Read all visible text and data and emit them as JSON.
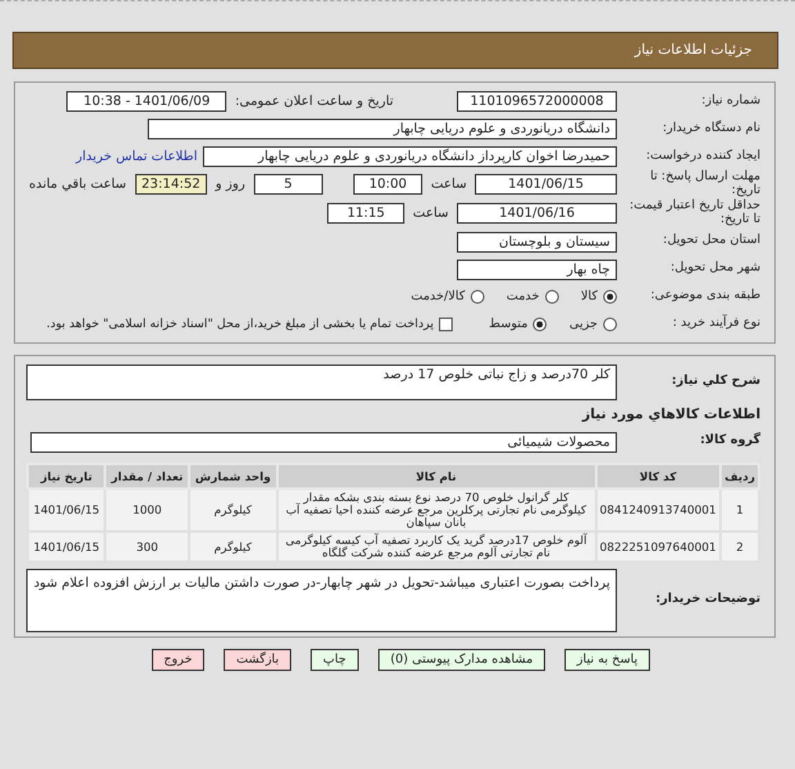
{
  "header": {
    "title": "جزئیات اطلاعات نیاز"
  },
  "need_number": {
    "label": "شماره نیاز:",
    "value": "1101096572000008"
  },
  "announce": {
    "label": "تاریخ و ساعت اعلان عمومی:",
    "value": "1401/06/09 - 10:38"
  },
  "buyer_org": {
    "label": "نام دستگاه خریدار:",
    "value": "دانشگاه دریانوردی و علوم دریایی چابهار"
  },
  "creator": {
    "label": "ایجاد کننده درخواست:",
    "value": "حمیدرضا اخوان کارپرداز دانشگاه دریانوردی و علوم دریایی چابهار",
    "link": "اطلاعات تماس خریدار"
  },
  "deadline": {
    "label": "مهلت ارسال پاسخ: تا تاریخ:",
    "date": "1401/06/15",
    "time_label": "ساعت",
    "time": "10:00",
    "days": "5",
    "days_label": "روز و",
    "remaining": "23:14:52",
    "remaining_label": "ساعت باقي مانده"
  },
  "validity": {
    "label": "حداقل تاریخ اعتبار قیمت: تا تاریخ:",
    "date": "1401/06/16",
    "time_label": "ساعت",
    "time": "11:15"
  },
  "province": {
    "label": "استان محل تحویل:",
    "value": "سیستان و بلوچستان"
  },
  "city": {
    "label": "شهر محل تحویل:",
    "value": "چاه بهار"
  },
  "category": {
    "label": "طبقه بندی موضوعی:",
    "options": [
      {
        "label": "کالا",
        "selected": true
      },
      {
        "label": "خدمت",
        "selected": false
      },
      {
        "label": "کالا/خدمت",
        "selected": false
      }
    ]
  },
  "process": {
    "label": "نوع فرآیند خرید :",
    "options": [
      {
        "label": "جزیی",
        "selected": false
      },
      {
        "label": "متوسط",
        "selected": true
      }
    ],
    "treasury": {
      "checked": false,
      "text": "پرداخت تمام یا بخشی از مبلغ خرید،از محل \"اسناد خزانه اسلامی\" خواهد بود."
    }
  },
  "description": {
    "label": "شرح کلي نیاز:",
    "value": "کلر 70درصد و زاج نباتی خلوص 17 درصد"
  },
  "goods_title": "اطلاعات کالاهاي مورد نیاز",
  "goods_group": {
    "label": "گروه کالا:",
    "value": "محصولات شیمیائی"
  },
  "table": {
    "columns": [
      "ردیف",
      "کد کالا",
      "نام کالا",
      "واحد شمارش",
      "تعداد / مقدار",
      "تاریخ نیاز"
    ],
    "rows": [
      [
        "1",
        "0841240913740001",
        "کلر گرانول خلوص 70 درصد نوع بسته بندی بشکه مقدار کیلوگرمی نام تجارتی پرکلرین مرجع عرضه کننده احیا تصفیه آب بانان سپاهان",
        "کیلوگرم",
        "1000",
        "1401/06/15"
      ],
      [
        "2",
        "0822251097640001",
        "آلوم خلوص 17درصد گرید یک کاربرد تصفیه آب کیسه کیلوگرمی نام تجارتی آلوم مرجع عرضه کننده شرکت گلگاه",
        "کیلوگرم",
        "300",
        "1401/06/15"
      ]
    ]
  },
  "buyer_notes": {
    "label": "توضیحات خریدار:",
    "value": "پرداخت بصورت اعتباری میباشد-تحویل در شهر چابهار-در صورت داشتن مالیات بر ارزش افزوده اعلام شود"
  },
  "buttons": [
    {
      "label": "پاسخ به نیاز",
      "kind": "normal"
    },
    {
      "label": "مشاهده مدارک پیوستی (0)",
      "kind": "normal"
    },
    {
      "label": "چاپ",
      "kind": "normal"
    },
    {
      "label": "بازگشت",
      "kind": "danger"
    },
    {
      "label": "خروج",
      "kind": "danger"
    }
  ]
}
